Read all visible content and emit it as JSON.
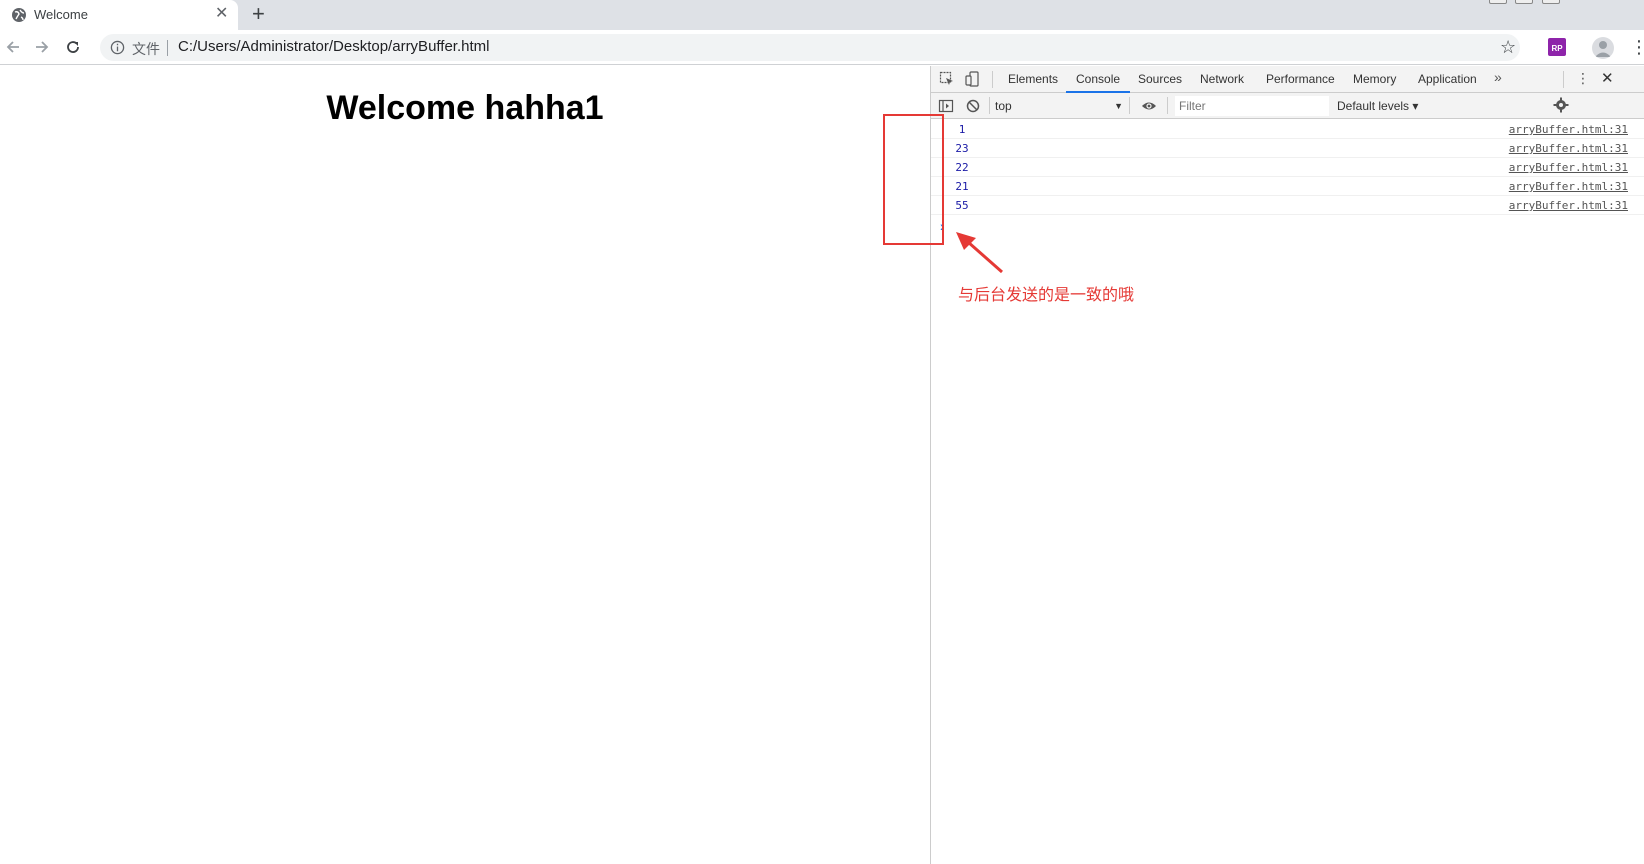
{
  "browser": {
    "tab_title": "Welcome",
    "close_glyph": "✕",
    "newtab_glyph": "+",
    "scheme_label": "文件",
    "url": "C:/Users/Administrator/Desktop/arryBuffer.html",
    "star_glyph": "☆",
    "ext_label": "RP",
    "kebab_glyph": "⋮"
  },
  "page": {
    "heading": "Welcome hahha1"
  },
  "devtools": {
    "tabs": [
      "Elements",
      "Console",
      "Sources",
      "Network",
      "Performance",
      "Memory",
      "Application"
    ],
    "active_tab": "Console",
    "more_glyph": "»",
    "kebab_glyph": "⋮",
    "close_glyph": "✕",
    "context": "top",
    "caret_glyph": "▼",
    "filter_placeholder": "Filter",
    "levels": "Default levels ▾",
    "console_rows": [
      {
        "value": "1",
        "source": "arryBuffer.html:31"
      },
      {
        "value": "23",
        "source": "arryBuffer.html:31"
      },
      {
        "value": "22",
        "source": "arryBuffer.html:31"
      },
      {
        "value": "21",
        "source": "arryBuffer.html:31"
      },
      {
        "value": "55",
        "source": "arryBuffer.html:31"
      }
    ],
    "prompt_glyph": "›"
  },
  "annotation": {
    "text": "与后台发送的是一致的哦",
    "color": "#e53935"
  }
}
